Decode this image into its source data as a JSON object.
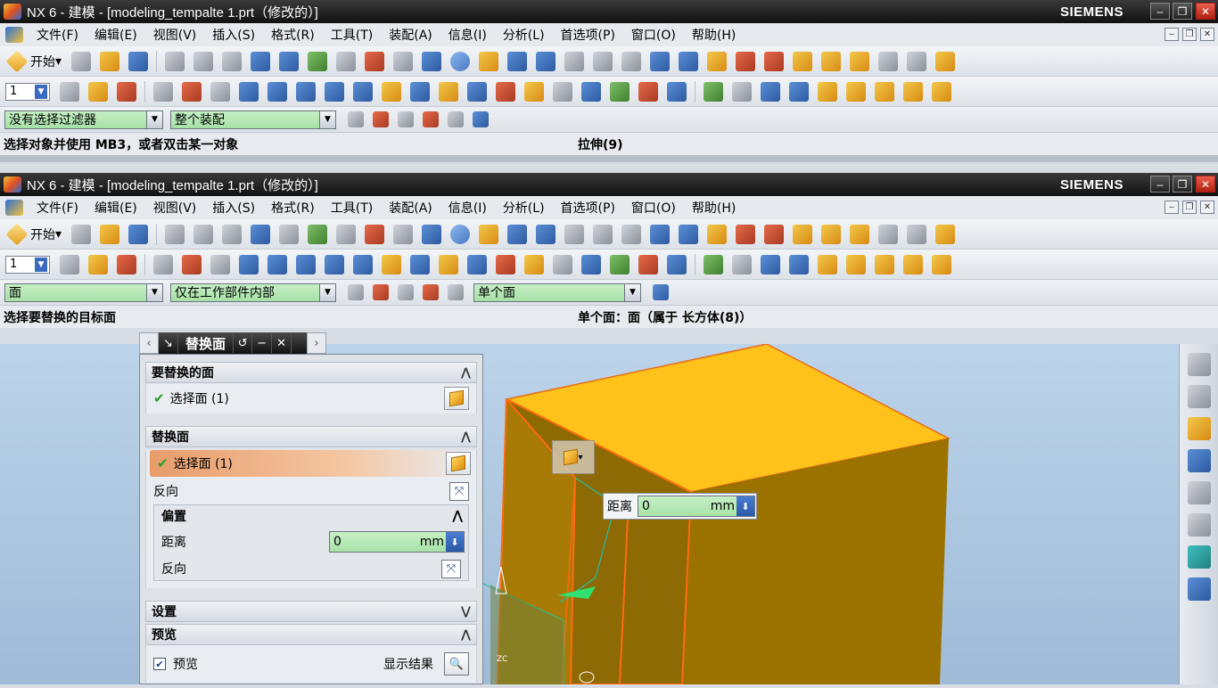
{
  "window1": {
    "title": "NX 6 - 建模 - [modeling_tempalte 1.prt（修改的）]",
    "brand": "SIEMENS",
    "menu": [
      "文件(F)",
      "编辑(E)",
      "视图(V)",
      "插入(S)",
      "格式(R)",
      "工具(T)",
      "装配(A)",
      "信息(I)",
      "分析(L)",
      "首选项(P)",
      "窗口(O)",
      "帮助(H)"
    ],
    "start_label": "开始",
    "layer_value": "1",
    "filter_value": "没有选择过滤器",
    "scope_value": "整个装配",
    "cue_left": "选择对象并使用 MB3，或者双击某一对象",
    "cue_right": "拉伸(9)"
  },
  "window2": {
    "title": "NX 6 - 建模 - [modeling_tempalte 1.prt（修改的）]",
    "brand": "SIEMENS",
    "menu": [
      "文件(F)",
      "编辑(E)",
      "视图(V)",
      "插入(S)",
      "格式(R)",
      "工具(T)",
      "装配(A)",
      "信息(I)",
      "分析(L)",
      "首选项(P)",
      "窗口(O)",
      "帮助(H)"
    ],
    "start_label": "开始",
    "layer_value": "1",
    "filter_value": "面",
    "scope_value": "仅在工作部件内部",
    "face_rule_value": "单个面",
    "cue_left": "选择要替换的目标面",
    "cue_right": "单个面：面（属于 长方体(8)）"
  },
  "dialog": {
    "title": "替换面",
    "group1_title": "要替换的面",
    "group1_select": "选择面 (1)",
    "group2_title": "替换面",
    "group2_select": "选择面 (1)",
    "reverse_label": "反向",
    "offset_title": "偏置",
    "distance_label": "距离",
    "distance_value": "0",
    "unit": "mm",
    "offset_reverse_label": "反向",
    "settings_title": "设置",
    "preview_title": "预览",
    "preview_label": "预览",
    "show_result_label": "显示结果"
  },
  "float_input": {
    "label": "距离",
    "value": "0",
    "unit": "mm"
  },
  "viewport": {
    "axis_label": "ZC",
    "block_color": "#c98a00"
  }
}
